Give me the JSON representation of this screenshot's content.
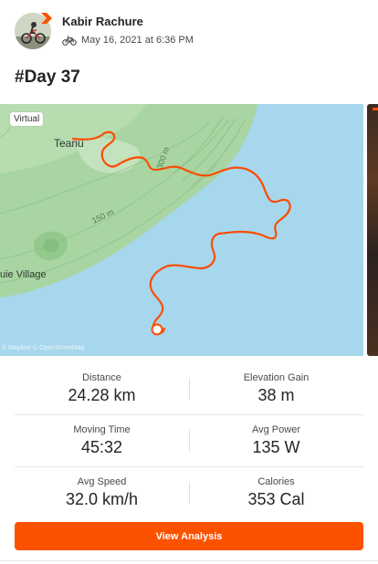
{
  "header": {
    "athlete_name": "Kabir Rachure",
    "timestamp": "May 16, 2021 at 6:36 PM",
    "activity_icon": "bike-icon",
    "badge_icon": "subscriber-chevron-icon"
  },
  "activity": {
    "title": "#Day 37"
  },
  "map": {
    "tag": "Virtual",
    "labels": {
      "town": "Teanu",
      "village": "uie Village",
      "contour_150": "150 m",
      "contour_300": "300 m"
    },
    "attribution": "© Mapbox © OpenStreetMap",
    "colors": {
      "land": "#a8d5a2",
      "water": "#a7d7ec",
      "route": "#fc4c02"
    }
  },
  "stats": [
    {
      "left": {
        "label": "Distance",
        "value": "24.28 km"
      },
      "right": {
        "label": "Elevation Gain",
        "value": "38 m"
      }
    },
    {
      "left": {
        "label": "Moving Time",
        "value": "45:32"
      },
      "right": {
        "label": "Avg Power",
        "value": "135 W"
      }
    },
    {
      "left": {
        "label": "Avg Speed",
        "value": "32.0 km/h"
      },
      "right": {
        "label": "Calories",
        "value": "353 Cal"
      }
    }
  ],
  "actions": {
    "view_analysis": "View Analysis"
  },
  "colors": {
    "accent": "#fc5200",
    "text": "#242428",
    "muted": "#494950"
  }
}
